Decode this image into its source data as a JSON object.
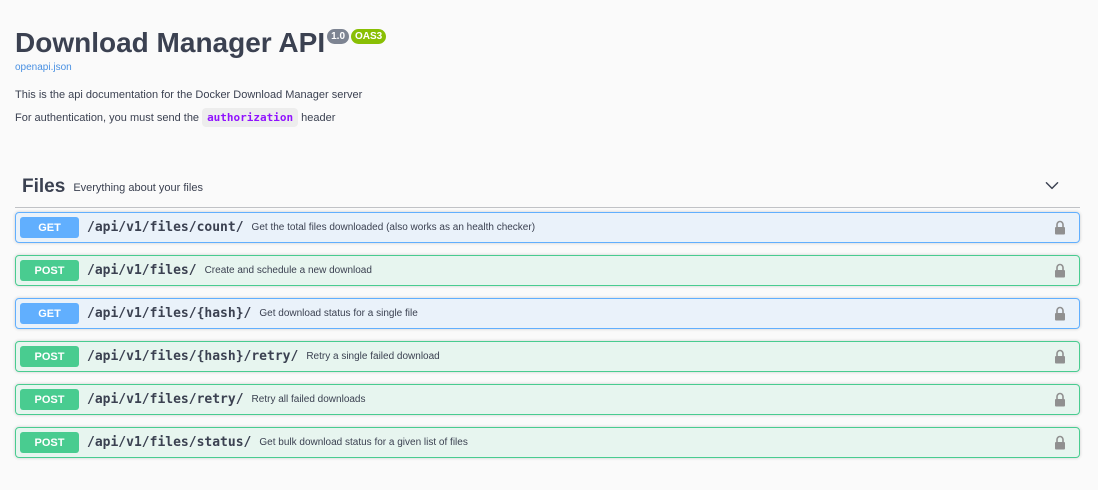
{
  "info": {
    "title": "Download Manager API",
    "version_badge": "1.0",
    "oas_badge": "OAS3",
    "spec_link": "openapi.json",
    "description": "This is the api documentation for the Docker Download Manager server",
    "auth_prefix": "For authentication, you must send the",
    "auth_code": "authorization",
    "auth_suffix": "header"
  },
  "tag": {
    "name": "Files",
    "description": "Everything about your files",
    "chevron_icon": "chevron-down-icon"
  },
  "colors": {
    "get": "#61affe",
    "post": "#49cc90",
    "badge_version": "#7d8492",
    "badge_oas": "#89bf04",
    "code": "#9012fe"
  },
  "operations": [
    {
      "method": "GET",
      "path": "/api/v1/files/count/",
      "summary": "Get the total files downloaded (also works as an health checker)",
      "icon": "lock-icon"
    },
    {
      "method": "POST",
      "path": "/api/v1/files/",
      "summary": "Create and schedule a new download",
      "icon": "lock-icon"
    },
    {
      "method": "GET",
      "path": "/api/v1/files/{hash}/",
      "summary": "Get download status for a single file",
      "icon": "lock-icon"
    },
    {
      "method": "POST",
      "path": "/api/v1/files/{hash}/retry/",
      "summary": "Retry a single failed download",
      "icon": "lock-icon"
    },
    {
      "method": "POST",
      "path": "/api/v1/files/retry/",
      "summary": "Retry all failed downloads",
      "icon": "lock-icon"
    },
    {
      "method": "POST",
      "path": "/api/v1/files/status/",
      "summary": "Get bulk download status for a given list of files",
      "icon": "lock-icon"
    }
  ]
}
